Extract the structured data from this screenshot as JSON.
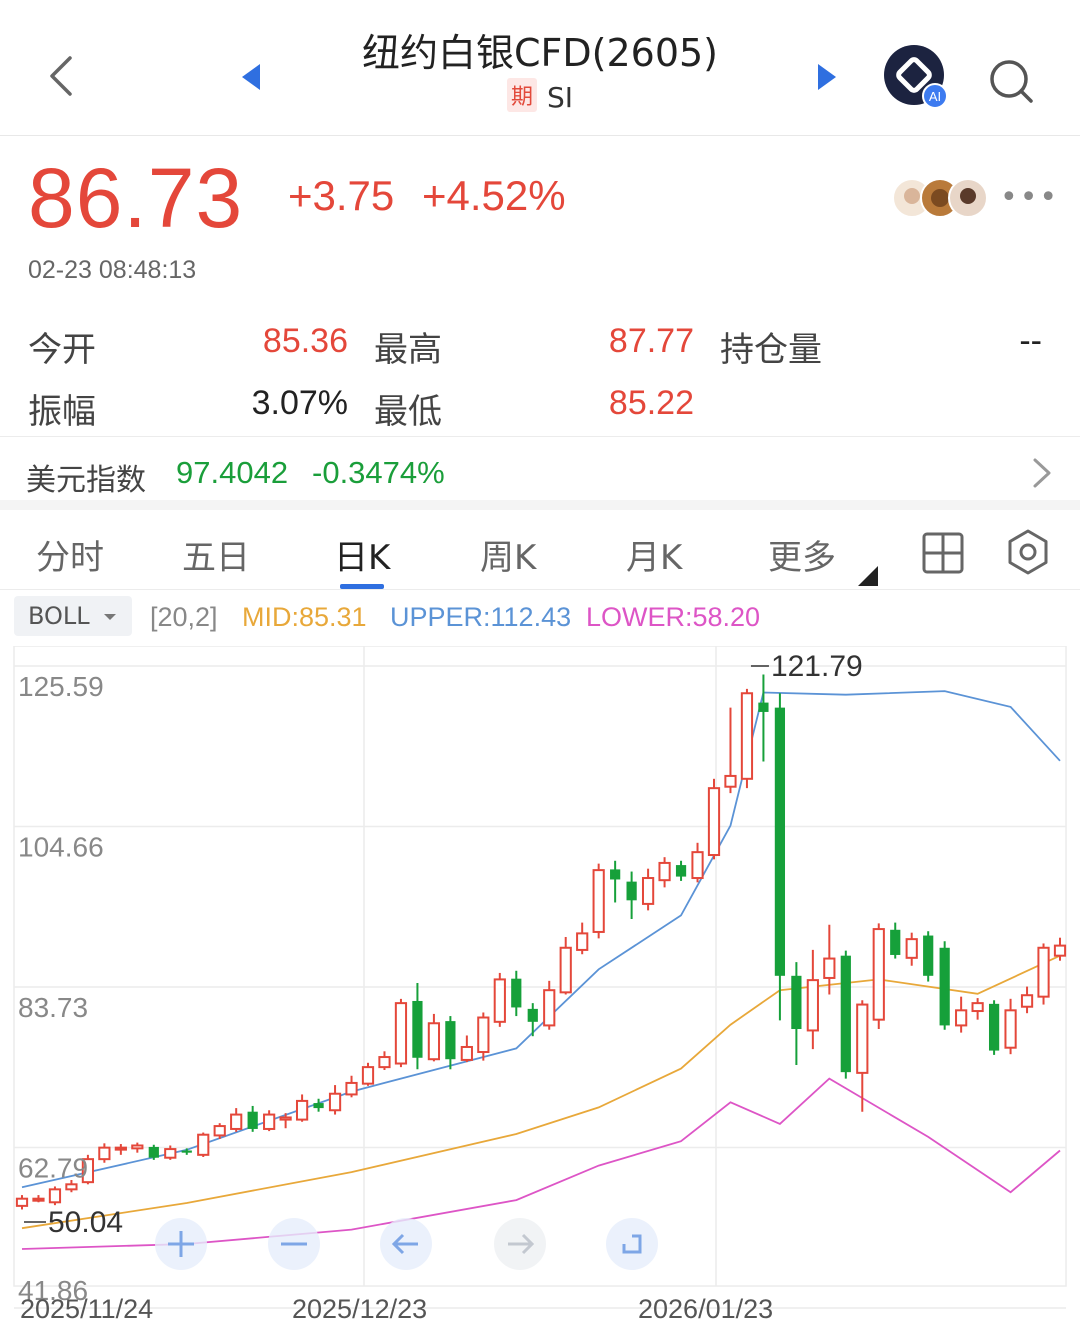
{
  "header": {
    "title": "纽约白银CFD(2605)",
    "tag": "期",
    "code": "SI",
    "ai_label": "AI"
  },
  "quote": {
    "price": "86.73",
    "change": "+3.75",
    "change_pct": "+4.52%",
    "timestamp": "02-23 08:48:13"
  },
  "stats": {
    "open_label": "今开",
    "open": "85.36",
    "high_label": "最高",
    "high": "87.77",
    "oi_label": "持仓量",
    "oi": "--",
    "amp_label": "振幅",
    "amp": "3.07%",
    "low_label": "最低",
    "low": "85.22"
  },
  "usd_index": {
    "label": "美元指数",
    "value": "97.4042",
    "change_pct": "-0.3474%"
  },
  "tabs": [
    {
      "label": "分时"
    },
    {
      "label": "五日"
    },
    {
      "label": "日K"
    },
    {
      "label": "周K"
    },
    {
      "label": "月K"
    },
    {
      "label": "更多"
    }
  ],
  "indicator": {
    "name": "BOLL",
    "params": "[20,2]",
    "mid": "MID:85.31",
    "upper": "UPPER:112.43",
    "lower": "LOWER:58.20"
  },
  "colors": {
    "up": "#e4473a",
    "down": "#16a03a",
    "mid": "#e8a83a",
    "upper": "#5b93d6",
    "lower": "#dd55c6",
    "accent": "#2f6fe0"
  },
  "chart_data": {
    "type": "candlestick",
    "y_ticks": [
      "125.59",
      "104.66",
      "83.73",
      "62.79",
      "41.86"
    ],
    "x_ticks": [
      "2025/11/24",
      "2025/12/23",
      "2026/01/23"
    ],
    "max_label": "121.79",
    "min_label": "50.04",
    "ylim": [
      41.86,
      125.59
    ],
    "candles": [
      [
        50.5,
        51.5,
        50.0,
        52.0
      ],
      [
        51.5,
        51.5,
        51.0,
        52.0
      ],
      [
        51.0,
        52.8,
        50.6,
        53.2
      ],
      [
        52.8,
        53.5,
        52.4,
        54.1
      ],
      [
        53.8,
        57.0,
        53.5,
        57.6
      ],
      [
        57.0,
        58.6,
        56.5,
        59.2
      ],
      [
        58.4,
        58.6,
        57.6,
        59.1
      ],
      [
        58.5,
        58.9,
        57.9,
        59.3
      ],
      [
        58.7,
        57.2,
        56.9,
        59.0
      ],
      [
        57.2,
        58.4,
        56.9,
        58.9
      ],
      [
        58.2,
        57.9,
        57.6,
        58.5
      ],
      [
        57.6,
        60.4,
        57.3,
        60.7
      ],
      [
        60.3,
        61.6,
        59.8,
        62.0
      ],
      [
        61.2,
        63.2,
        60.8,
        64.1
      ],
      [
        63.6,
        61.2,
        60.8,
        64.4
      ],
      [
        61.2,
        63.2,
        60.9,
        63.8
      ],
      [
        62.5,
        62.8,
        61.3,
        63.4
      ],
      [
        62.5,
        65.1,
        62.2,
        66.0
      ],
      [
        64.8,
        64.1,
        63.6,
        65.4
      ],
      [
        63.8,
        66.1,
        63.2,
        67.3
      ],
      [
        66.0,
        67.6,
        65.6,
        68.6
      ],
      [
        67.5,
        69.8,
        67.2,
        70.4
      ],
      [
        69.8,
        71.2,
        69.4,
        72.0
      ],
      [
        70.3,
        78.7,
        69.8,
        79.3
      ],
      [
        79.0,
        71.1,
        69.5,
        81.5
      ],
      [
        70.9,
        75.9,
        70.6,
        77.2
      ],
      [
        76.2,
        70.9,
        69.5,
        76.9
      ],
      [
        70.8,
        72.6,
        70.5,
        74.2
      ],
      [
        71.9,
        76.7,
        70.7,
        77.4
      ],
      [
        76.1,
        82.0,
        75.4,
        82.9
      ],
      [
        82.1,
        78.1,
        76.9,
        83.2
      ],
      [
        77.9,
        76.1,
        74.1,
        78.7
      ],
      [
        75.6,
        80.5,
        75.0,
        81.8
      ],
      [
        80.2,
        86.4,
        79.9,
        87.9
      ],
      [
        86.1,
        88.4,
        85.5,
        89.9
      ],
      [
        88.6,
        97.2,
        87.7,
        98.1
      ],
      [
        97.3,
        95.9,
        92.7,
        98.5
      ],
      [
        95.6,
        93.0,
        90.4,
        97.0
      ],
      [
        92.5,
        96.1,
        91.6,
        97.4
      ],
      [
        95.8,
        98.2,
        94.8,
        99.0
      ],
      [
        97.9,
        96.3,
        95.7,
        98.5
      ],
      [
        96.1,
        99.7,
        95.5,
        101.0
      ],
      [
        99.3,
        108.6,
        98.7,
        109.9
      ],
      [
        108.8,
        110.3,
        107.9,
        119.8
      ],
      [
        109.9,
        121.8,
        108.6,
        122.4
      ],
      [
        120.5,
        119.2,
        112.3,
        124.4
      ],
      [
        119.8,
        82.5,
        76.3,
        121.8
      ],
      [
        82.5,
        75.1,
        70.1,
        84.4
      ],
      [
        74.9,
        81.9,
        72.3,
        86.1
      ],
      [
        82.2,
        84.9,
        79.9,
        89.6
      ],
      [
        85.3,
        69.1,
        68.2,
        86.0
      ],
      [
        69.0,
        78.5,
        63.6,
        79.1
      ],
      [
        76.4,
        89.0,
        75.1,
        89.8
      ],
      [
        88.9,
        85.4,
        84.9,
        89.9
      ],
      [
        85.0,
        87.6,
        83.9,
        88.5
      ],
      [
        88.1,
        82.5,
        81.7,
        88.7
      ],
      [
        86.4,
        75.6,
        75.0,
        87.3
      ],
      [
        75.6,
        77.7,
        74.6,
        79.6
      ],
      [
        77.6,
        78.7,
        76.4,
        79.4
      ],
      [
        78.6,
        72.1,
        71.5,
        79.1
      ],
      [
        72.5,
        77.7,
        71.6,
        79.3
      ],
      [
        78.2,
        79.8,
        77.3,
        81.0
      ],
      [
        79.6,
        86.4,
        78.5,
        87.0
      ],
      [
        85.3,
        86.7,
        84.6,
        87.8
      ]
    ],
    "mid_line": [
      [
        0,
        47.4
      ],
      [
        10,
        50.9
      ],
      [
        20,
        55.2
      ],
      [
        30,
        60.5
      ],
      [
        35,
        64.2
      ],
      [
        40,
        69.6
      ],
      [
        43,
        75.7
      ],
      [
        46,
        80.5
      ],
      [
        52,
        82.0
      ],
      [
        58,
        80.0
      ],
      [
        63,
        85.3
      ]
    ],
    "upper_line": [
      [
        0,
        53.1
      ],
      [
        10,
        58.3
      ],
      [
        20,
        66.4
      ],
      [
        30,
        72.4
      ],
      [
        35,
        83.4
      ],
      [
        40,
        90.9
      ],
      [
        43,
        103.4
      ],
      [
        45,
        121.9
      ],
      [
        50,
        121.6
      ],
      [
        56,
        122.1
      ],
      [
        60,
        119.9
      ],
      [
        63,
        112.4
      ]
    ],
    "lower_line": [
      [
        0,
        44.5
      ],
      [
        10,
        45.2
      ],
      [
        20,
        47.2
      ],
      [
        30,
        51.3
      ],
      [
        35,
        56.1
      ],
      [
        40,
        59.5
      ],
      [
        43,
        64.9
      ],
      [
        46,
        61.9
      ],
      [
        49,
        68.2
      ],
      [
        55,
        60.1
      ],
      [
        60,
        52.4
      ],
      [
        63,
        58.2
      ]
    ]
  }
}
